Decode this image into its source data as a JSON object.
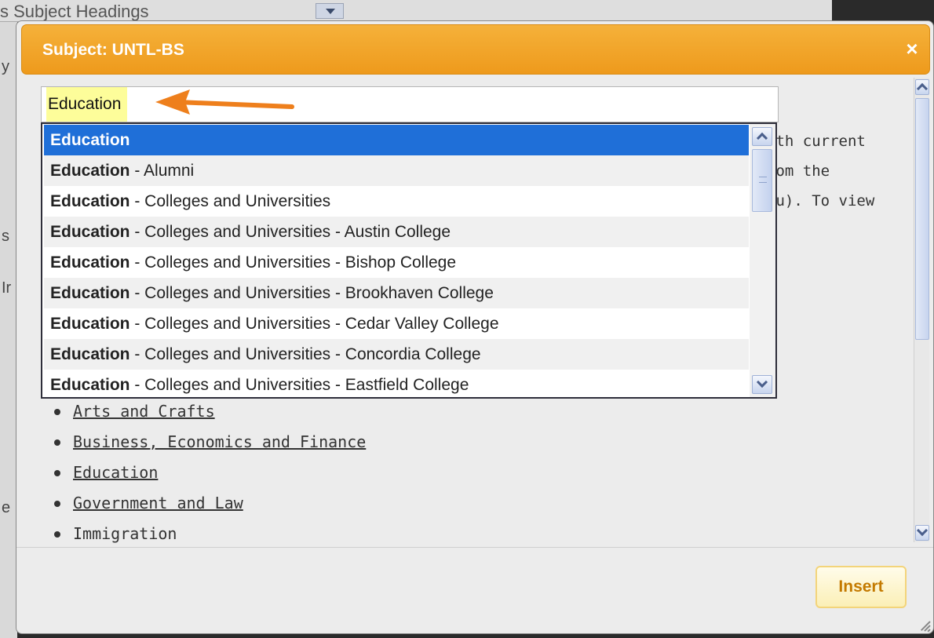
{
  "background": {
    "strip_text": "s Subject Headings",
    "left_chars": [
      "y",
      "s",
      "Ir",
      "e"
    ]
  },
  "dialog": {
    "title": "Subject: UNTL-BS",
    "close_symbol": "×",
    "insert_label": "Insert",
    "description_lines": [
      "ith current",
      "rom the",
      "du). To view"
    ]
  },
  "search": {
    "value": "Education"
  },
  "autocomplete": {
    "items": [
      {
        "bold": "Education",
        "rest": "",
        "selected": true
      },
      {
        "bold": "Education",
        "rest": " - Alumni"
      },
      {
        "bold": "Education",
        "rest": " - Colleges and Universities"
      },
      {
        "bold": "Education",
        "rest": " - Colleges and Universities - Austin College"
      },
      {
        "bold": "Education",
        "rest": " - Colleges and Universities - Bishop College"
      },
      {
        "bold": "Education",
        "rest": " - Colleges and Universities - Brookhaven College"
      },
      {
        "bold": "Education",
        "rest": " - Colleges and Universities - Cedar Valley College"
      },
      {
        "bold": "Education",
        "rest": " - Colleges and Universities - Concordia College"
      },
      {
        "bold": "Education",
        "rest": " - Colleges and Universities - Eastfield College"
      }
    ]
  },
  "categories": [
    {
      "label": "Arts and Crafts",
      "link": true
    },
    {
      "label": "Business, Economics and Finance",
      "link": true
    },
    {
      "label": "Education",
      "link": true
    },
    {
      "label": "Government and Law",
      "link": true
    },
    {
      "label": "Immigration",
      "link": false
    }
  ],
  "colors": {
    "title_bar": "#f0a226",
    "selected_row": "#1f6fd8",
    "annotation_arrow": "#ee7f1c",
    "search_highlight": "#fdfd9a"
  }
}
